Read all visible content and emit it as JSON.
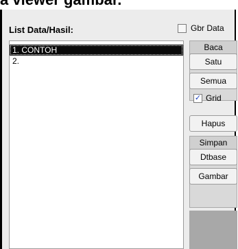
{
  "header": {
    "title_partial": "a viewer gambar."
  },
  "list": {
    "label": "List Data/Hasil:",
    "items": [
      "1. CONTOH",
      "2."
    ]
  },
  "gbr": {
    "label": "Gbr Data",
    "checked": false
  },
  "side": {
    "baca_label": "Baca",
    "satu_label": "Satu",
    "semua_label": "Semua",
    "grid_label": "Grid",
    "grid_checked": true,
    "hapus_label": "Hapus",
    "simpan_label": "Simpan",
    "dtbase_label": "Dtbase",
    "gambar_label": "Gambar"
  }
}
